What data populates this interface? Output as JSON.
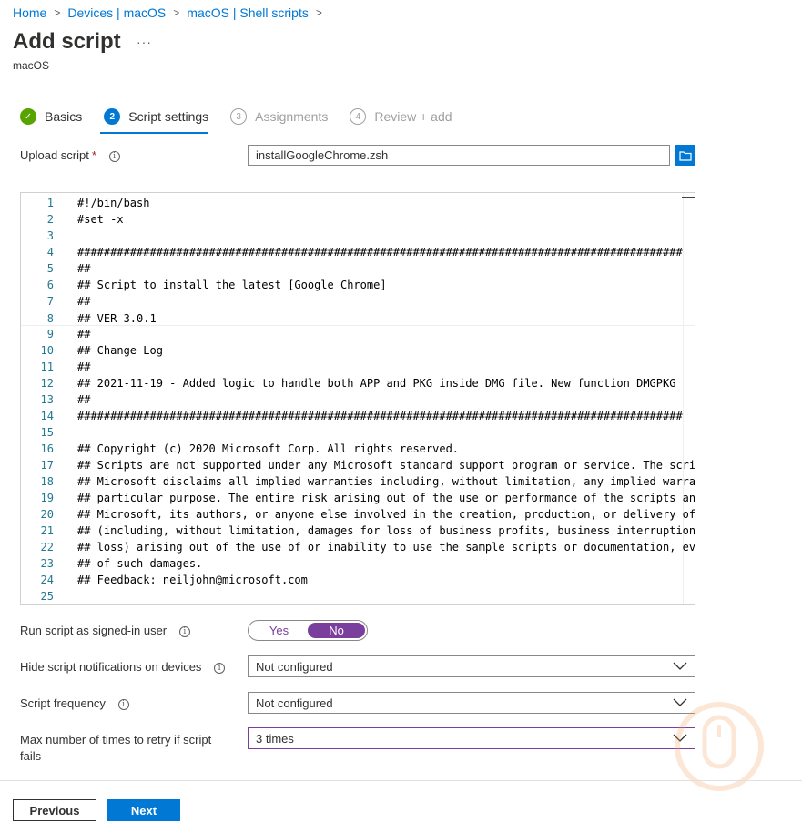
{
  "breadcrumb": {
    "items": [
      "Home",
      "Devices | macOS",
      "macOS | Shell scripts"
    ]
  },
  "page": {
    "title": "Add script",
    "subtitle": "macOS",
    "more": "···"
  },
  "steps": [
    {
      "number": "✓",
      "label": "Basics",
      "state": "done"
    },
    {
      "number": "2",
      "label": "Script settings",
      "state": "active"
    },
    {
      "number": "3",
      "label": "Assignments",
      "state": "pending"
    },
    {
      "number": "4",
      "label": "Review + add",
      "state": "pending"
    }
  ],
  "upload": {
    "label": "Upload script",
    "required_mark": "*",
    "value": "installGoogleChrome.zsh"
  },
  "editor": {
    "lines": [
      {
        "n": "1",
        "text": "#!/bin/bash"
      },
      {
        "n": "2",
        "text": "#set -x"
      },
      {
        "n": "3",
        "text": ""
      },
      {
        "n": "4",
        "text": "############################################################################################"
      },
      {
        "n": "5",
        "text": "##"
      },
      {
        "n": "6",
        "text": "## Script to install the latest [Google Chrome]"
      },
      {
        "n": "7",
        "text": "##"
      },
      {
        "n": "8",
        "text": "## VER 3.0.1"
      },
      {
        "n": "9",
        "text": "##"
      },
      {
        "n": "10",
        "text": "## Change Log"
      },
      {
        "n": "11",
        "text": "##"
      },
      {
        "n": "12",
        "text": "## 2021-11-19 - Added logic to handle both APP and PKG inside DMG file. New function DMGPKG"
      },
      {
        "n": "13",
        "text": "##"
      },
      {
        "n": "14",
        "text": "############################################################################################"
      },
      {
        "n": "15",
        "text": ""
      },
      {
        "n": "16",
        "text": "## Copyright (c) 2020 Microsoft Corp. All rights reserved."
      },
      {
        "n": "17",
        "text": "## Scripts are not supported under any Microsoft standard support program or service. The scri"
      },
      {
        "n": "18",
        "text": "## Microsoft disclaims all implied warranties including, without limitation, any implied warra"
      },
      {
        "n": "19",
        "text": "## particular purpose. The entire risk arising out of the use or performance of the scripts an"
      },
      {
        "n": "20",
        "text": "## Microsoft, its authors, or anyone else involved in the creation, production, or delivery of"
      },
      {
        "n": "21",
        "text": "## (including, without limitation, damages for loss of business profits, business interruption"
      },
      {
        "n": "22",
        "text": "## loss) arising out of the use of or inability to use the sample scripts or documentation, ev"
      },
      {
        "n": "23",
        "text": "## of such damages."
      },
      {
        "n": "24",
        "text": "## Feedback: neiljohn@microsoft.com"
      },
      {
        "n": "25",
        "text": ""
      }
    ]
  },
  "run_as_user": {
    "label": "Run script as signed-in user",
    "yes": "Yes",
    "no": "No",
    "selected": "No"
  },
  "hide_notifications": {
    "label": "Hide script notifications on devices",
    "value": "Not configured"
  },
  "frequency": {
    "label": "Script frequency",
    "value": "Not configured"
  },
  "retry": {
    "label_line1": "Max number of times to retry if script",
    "label_line2": "fails",
    "value": "3 times"
  },
  "buttons": {
    "previous": "Previous",
    "next": "Next"
  },
  "colors": {
    "accent": "#0078d4",
    "toggle": "#7a3e9d",
    "success": "#57a300"
  }
}
